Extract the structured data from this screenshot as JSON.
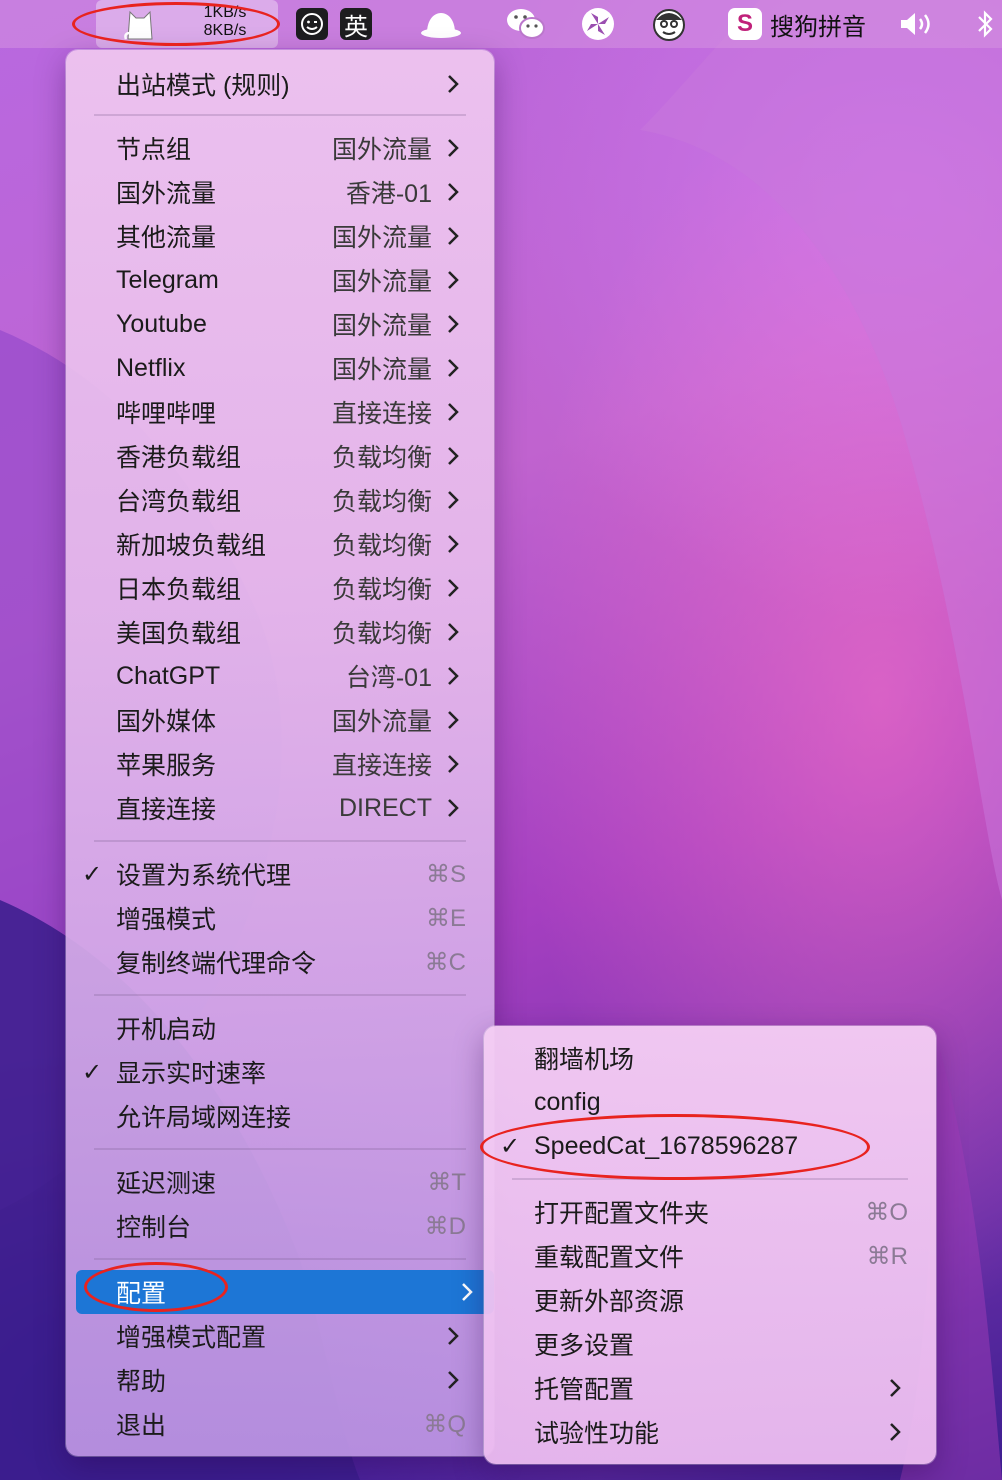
{
  "menubar": {
    "speed_up": "1KB/s",
    "speed_down": "8KB/s",
    "input_badge": "英",
    "ime_name": "搜狗拼音",
    "ime_badge": "S",
    "icons": [
      "clash-cat-icon",
      "emoji-face-icon",
      "english-input-icon",
      "cloud-icon",
      "wechat-icon",
      "pinwheel-icon",
      "face-icon",
      "sogou-icon",
      "volume-icon",
      "bluetooth-icon"
    ]
  },
  "main_menu": {
    "outbound_mode": "出站模式 (规则)",
    "proxy_groups": [
      {
        "name": "节点组",
        "value": "国外流量"
      },
      {
        "name": "国外流量",
        "value": "香港-01"
      },
      {
        "name": "其他流量",
        "value": "国外流量"
      },
      {
        "name": "Telegram",
        "value": "国外流量"
      },
      {
        "name": "Youtube",
        "value": "国外流量"
      },
      {
        "name": "Netflix",
        "value": "国外流量"
      },
      {
        "name": "哔哩哔哩",
        "value": "直接连接"
      },
      {
        "name": "香港负载组",
        "value": "负载均衡"
      },
      {
        "name": "台湾负载组",
        "value": "负载均衡"
      },
      {
        "name": "新加坡负载组",
        "value": "负载均衡"
      },
      {
        "name": "日本负载组",
        "value": "负载均衡"
      },
      {
        "name": "美国负载组",
        "value": "负载均衡"
      },
      {
        "name": "ChatGPT",
        "value": "台湾-01"
      },
      {
        "name": "国外媒体",
        "value": "国外流量"
      },
      {
        "name": "苹果服务",
        "value": "直接连接"
      },
      {
        "name": "直接连接",
        "value": "DIRECT"
      }
    ],
    "set_system_proxy": {
      "label": "设置为系统代理",
      "shortcut": "⌘S",
      "checked": true
    },
    "enhanced_mode": {
      "label": "增强模式",
      "shortcut": "⌘E"
    },
    "copy_terminal": {
      "label": "复制终端代理命令",
      "shortcut": "⌘C"
    },
    "launch_at_login": {
      "label": "开机启动"
    },
    "show_speed": {
      "label": "显示实时速率",
      "checked": true
    },
    "allow_lan": {
      "label": "允许局域网连接"
    },
    "latency_test": {
      "label": "延迟测速",
      "shortcut": "⌘T"
    },
    "dashboard": {
      "label": "控制台",
      "shortcut": "⌘D"
    },
    "config": {
      "label": "配置"
    },
    "enhanced_config": {
      "label": "增强模式配置"
    },
    "help": {
      "label": "帮助"
    },
    "quit": {
      "label": "退出",
      "shortcut": "⌘Q"
    },
    "check_mark": "✓"
  },
  "config_submenu": {
    "profiles": [
      {
        "label": "翻墙机场",
        "checked": false
      },
      {
        "label": "config",
        "checked": false
      },
      {
        "label": "SpeedCat_1678596287",
        "checked": true
      }
    ],
    "open_folder": {
      "label": "打开配置文件夹",
      "shortcut": "⌘O"
    },
    "reload": {
      "label": "重载配置文件",
      "shortcut": "⌘R"
    },
    "update_external": {
      "label": "更新外部资源"
    },
    "more_settings": {
      "label": "更多设置"
    },
    "managed_config": {
      "label": "托管配置"
    },
    "experimental": {
      "label": "试验性功能"
    }
  },
  "colors": {
    "highlight": "#1d76d6",
    "annotation": "#e8231f"
  }
}
